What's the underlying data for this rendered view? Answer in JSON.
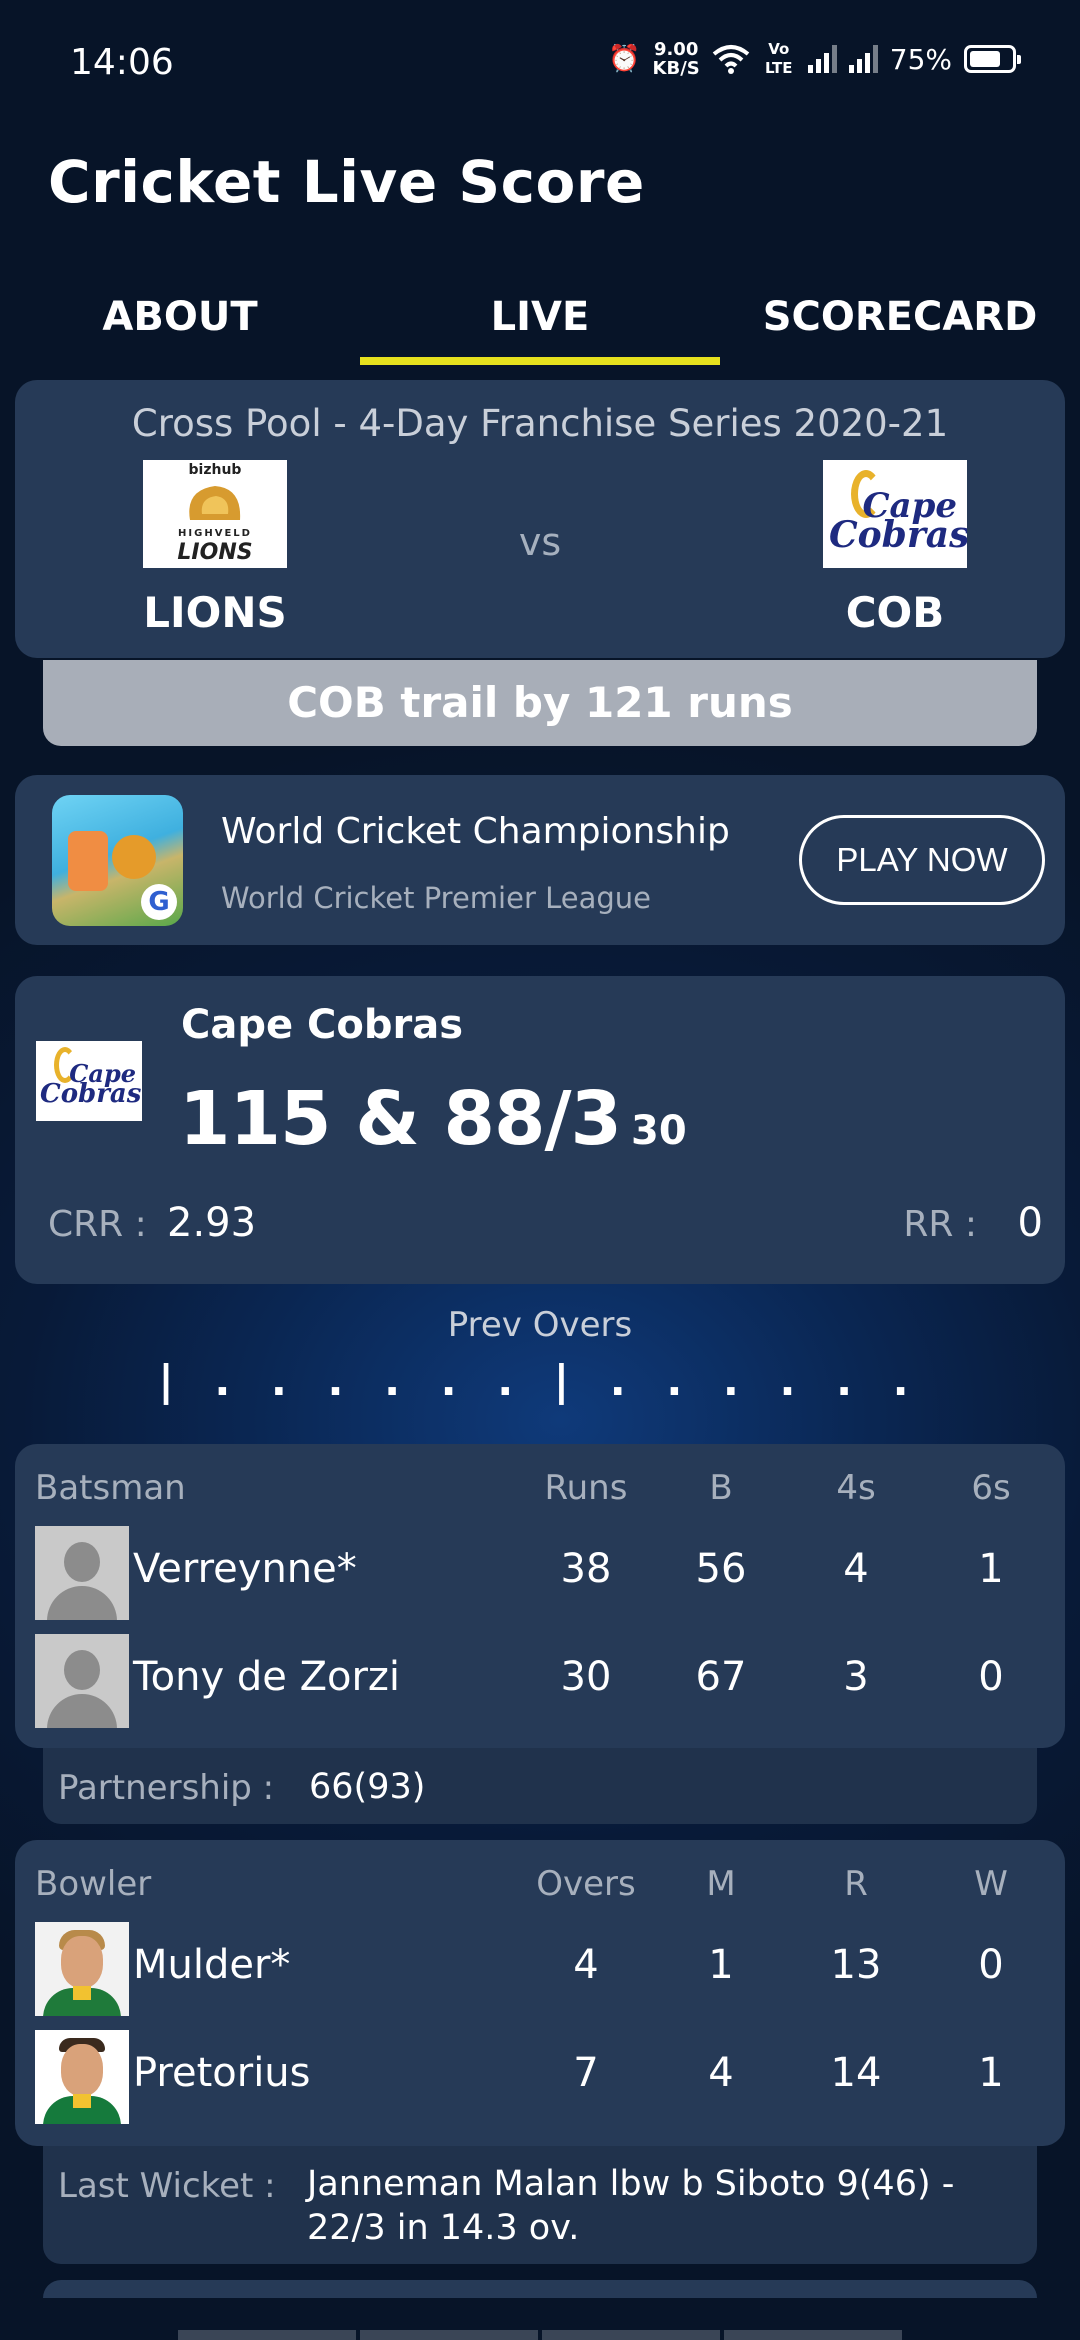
{
  "status_bar": {
    "time": "14:06",
    "net_speed_value": "9.00",
    "net_speed_unit": "KB/S",
    "volte": "Vo LTE",
    "battery_percent": "75%",
    "battery_level": 0.75,
    "icons": [
      "alarm-icon",
      "wifi-icon",
      "volte-icon",
      "signal-icon",
      "signal-icon",
      "battery-icon"
    ]
  },
  "app": {
    "title": "Cricket Live Score"
  },
  "tabs": [
    {
      "label": "ABOUT",
      "active": false
    },
    {
      "label": "LIVE",
      "active": true
    },
    {
      "label": "SCORECARD",
      "active": false
    }
  ],
  "match": {
    "series": "Cross Pool - 4-Day Franchise Series 2020-21",
    "vs": "vs",
    "team1": {
      "short": "LIONS",
      "logo_top": "bizhub",
      "logo_mid": "HIGHVELD",
      "logo_bottom": "LIONS"
    },
    "team2": {
      "short": "COB",
      "logo_line1": "Cape",
      "logo_line2": "Cobras"
    },
    "status": "COB trail by 121 runs"
  },
  "ad": {
    "title": "World Cricket Championship",
    "subtitle": "World Cricket Premier League",
    "cta": "PLAY NOW",
    "icon_badge": "G"
  },
  "score": {
    "team": "Cape Cobras",
    "logo_line1": "Cape",
    "logo_line2": "Cobras",
    "runs": "115 & 88/3",
    "overs": "30",
    "crr_label": "CRR :",
    "crr": "2.93",
    "rr_label": "RR :",
    "rr": "0"
  },
  "prev_overs": {
    "title": "Prev Overs",
    "sequence": "| . . . . . . | . . . . . ."
  },
  "batting": {
    "headers": [
      "Batsman",
      "Runs",
      "B",
      "4s",
      "6s"
    ],
    "rows": [
      {
        "name": "Verreynne*",
        "runs": "38",
        "balls": "56",
        "fours": "4",
        "sixes": "1"
      },
      {
        "name": "Tony de Zorzi",
        "runs": "30",
        "balls": "67",
        "fours": "3",
        "sixes": "0"
      }
    ],
    "partnership_label": "Partnership :",
    "partnership": "66(93)"
  },
  "bowling": {
    "headers": [
      "Bowler",
      "Overs",
      "M",
      "R",
      "W"
    ],
    "rows": [
      {
        "name": "Mulder*",
        "overs": "4",
        "maidens": "1",
        "runs": "13",
        "wickets": "0"
      },
      {
        "name": "Pretorius",
        "overs": "7",
        "maidens": "4",
        "runs": "14",
        "wickets": "1"
      }
    ],
    "last_wicket_label": "Last Wicket :",
    "last_wicket_line1": "Janneman Malan lbw b Siboto 9(46) -",
    "last_wicket_line2": "22/3 in 14.3 ov."
  }
}
